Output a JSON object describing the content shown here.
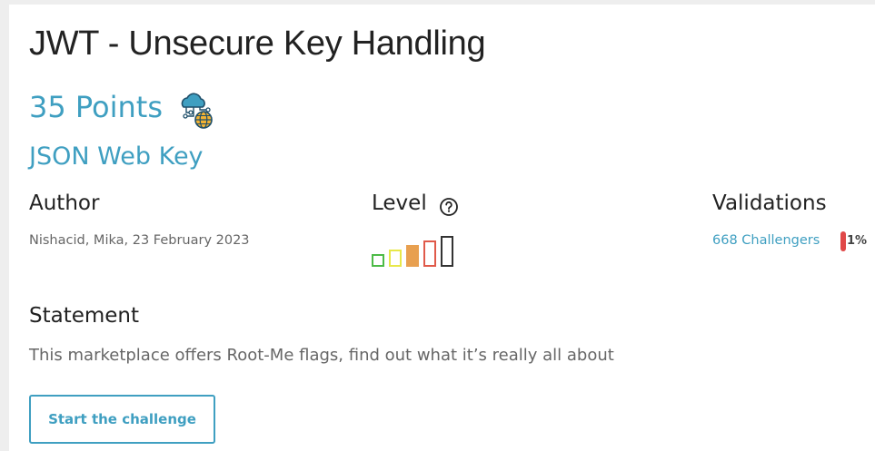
{
  "challenge": {
    "title": "JWT - Unsecure Key Handling",
    "points": "35 Points",
    "category_icon": "cloud-network-globe-icon",
    "subcategory": "JSON Web Key"
  },
  "author": {
    "label": "Author",
    "value": "Nishacid, Mika,  23 February 2023"
  },
  "level": {
    "label": "Level",
    "help_icon": "question-circle-icon",
    "current": 3,
    "total": 5,
    "colors": [
      "#4cbb47",
      "#e8e84a",
      "#e8a050",
      "#e05a4a",
      "#333333"
    ]
  },
  "validations": {
    "label": "Validations",
    "challengers": "668 Challengers",
    "percent_label": "1%",
    "percent": 1,
    "bar_color": "#e04848"
  },
  "statement": {
    "label": "Statement",
    "text": "This marketplace offers Root-Me flags, find out what it’s really all about"
  },
  "actions": {
    "start_label": "Start the challenge"
  },
  "colors": {
    "accent": "#3f9fc1",
    "text": "#222222",
    "muted": "#666666"
  }
}
